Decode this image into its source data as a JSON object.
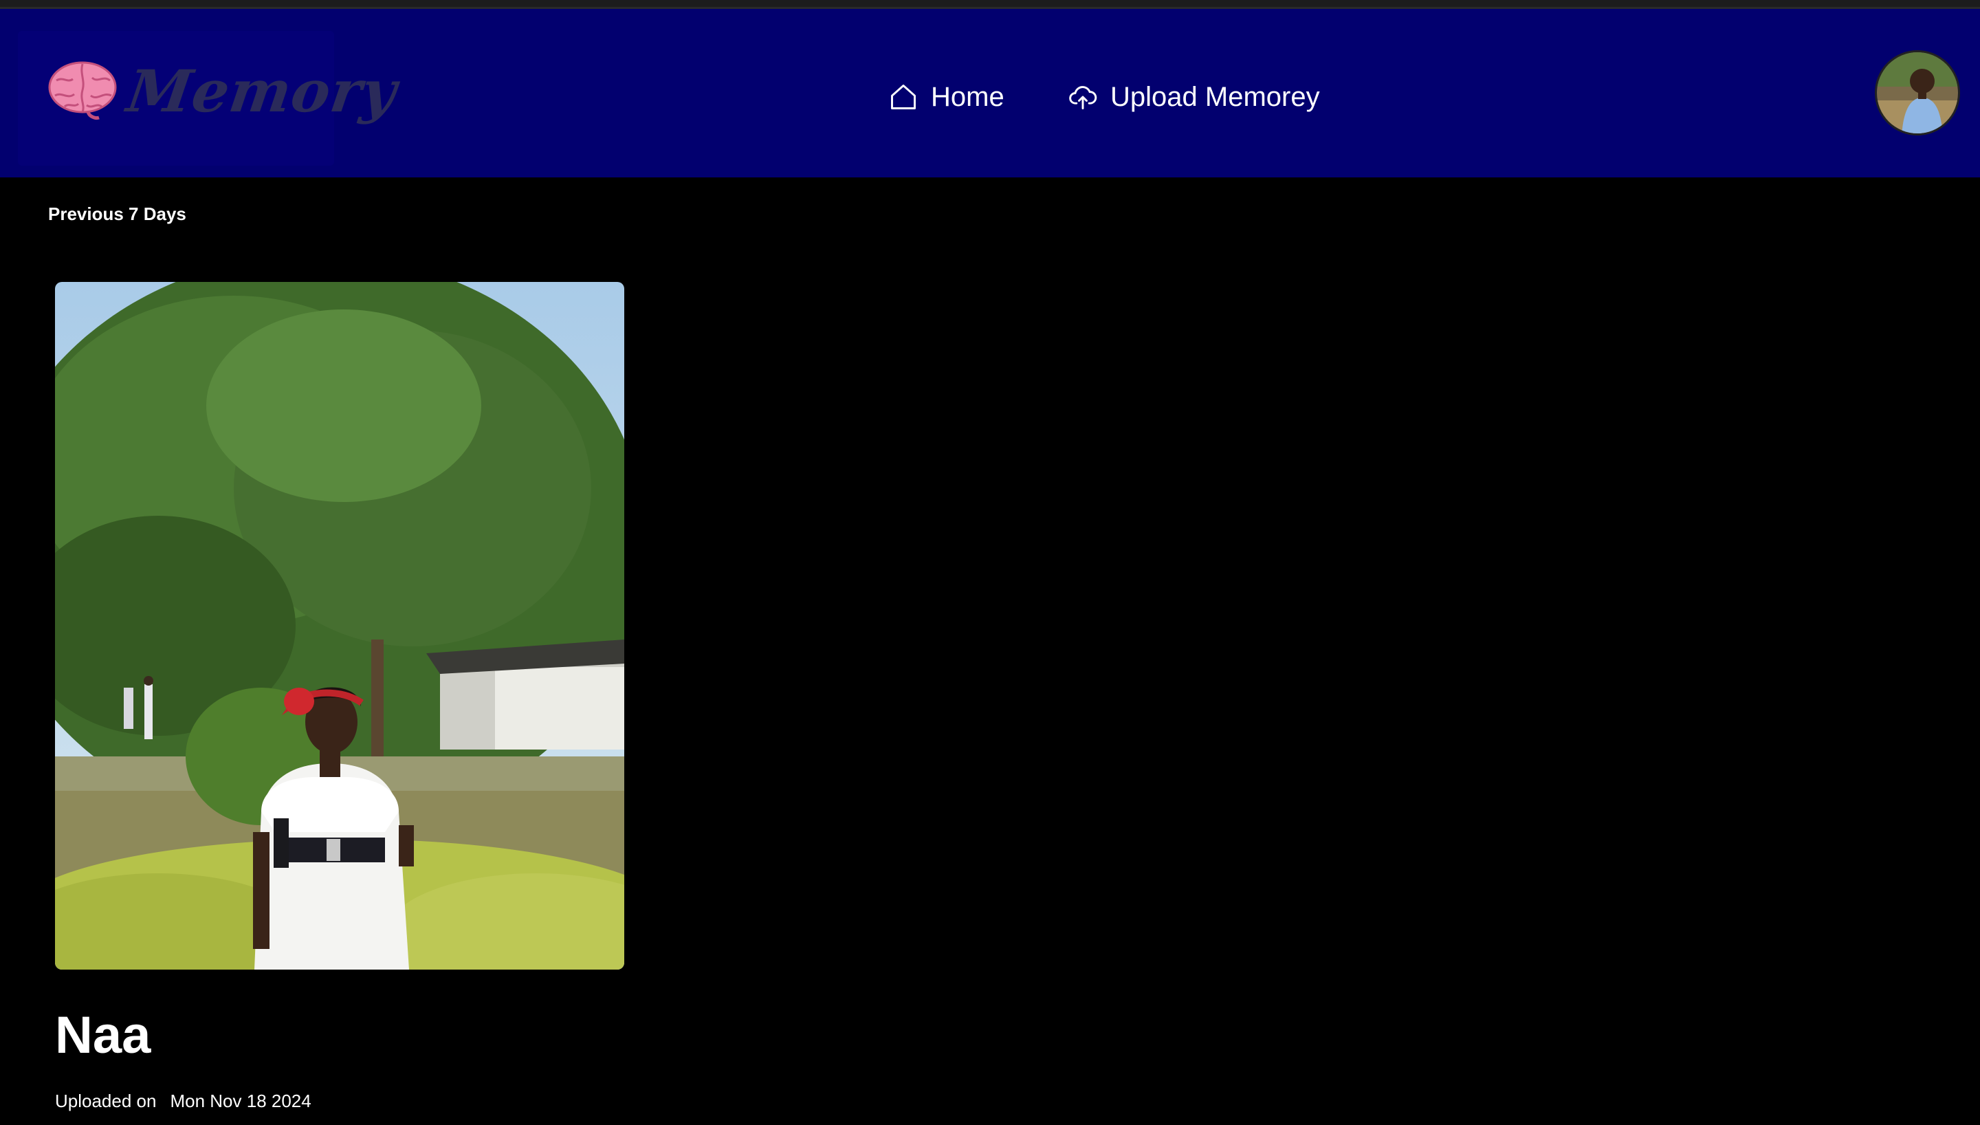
{
  "header": {
    "brand_name": "Memory",
    "brand_icon": "brain-icon",
    "nav": [
      {
        "label": "Home",
        "icon": "home-icon"
      },
      {
        "label": "Upload Memorey",
        "icon": "cloud-upload-icon"
      }
    ],
    "background_color": "#02006f"
  },
  "main": {
    "section_label": "Previous 7 Days",
    "memories": [
      {
        "title": "Naa",
        "uploaded_label": "Uploaded on",
        "uploaded_date": "Mon Nov 18 2024"
      }
    ]
  }
}
